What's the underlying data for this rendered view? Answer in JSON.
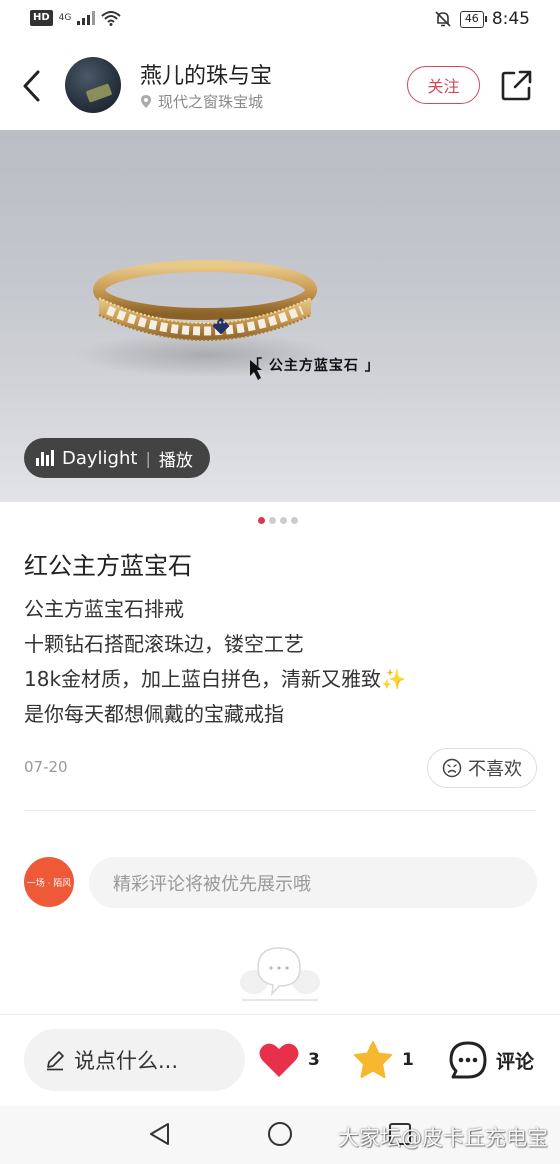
{
  "status_bar": {
    "network_badge": "HD",
    "signal": "4G",
    "battery": "46",
    "time": "8:45"
  },
  "header": {
    "shop_name": "燕儿的珠与宝",
    "location": "现代之窗珠宝城",
    "follow_label": "关注"
  },
  "hero": {
    "caption": "「 公主方蓝宝石 」",
    "music_track": "Daylight",
    "play_label": "播放",
    "page_count": 4,
    "active_page": 1
  },
  "post": {
    "title": "红公主方蓝宝石",
    "lines": [
      "公主方蓝宝石排戒",
      "十颗钻石搭配滚珠边，镂空工艺",
      "18k金材质，加上蓝白拼色，清新又雅致✨",
      "是你每天都想佩戴的宝藏戒指"
    ],
    "date": "07-20",
    "dislike_label": "不喜欢"
  },
  "comment": {
    "avatar_text": "一场 · 陌风",
    "placeholder": "精彩评论将被优先展示哦"
  },
  "action_bar": {
    "say_placeholder": "说点什么...",
    "likes": "3",
    "stars": "1",
    "comment_label": "评论"
  },
  "watermark": "大家坛@皮卡丘充电宝",
  "colors": {
    "accent": "#d24a5a",
    "dot_active": "#e0344a",
    "like_red": "#e8304a",
    "star_yellow": "#f5b82e"
  }
}
